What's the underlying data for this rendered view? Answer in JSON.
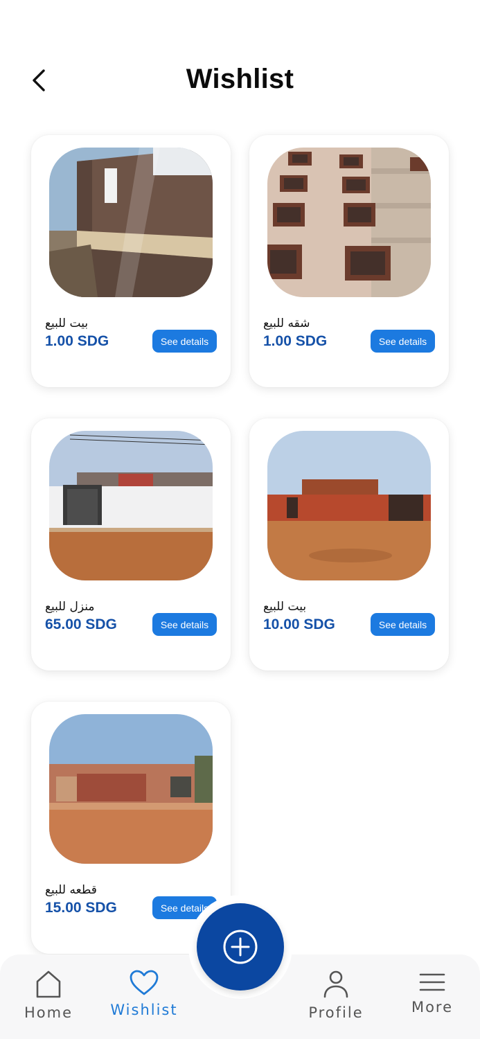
{
  "header": {
    "title": "Wishlist",
    "back_icon": "chevron-left-icon"
  },
  "listings": [
    {
      "name": "بيت للبيع",
      "price": "1.00 SDG",
      "button": "See details",
      "photo": "brick-wall-house-photo"
    },
    {
      "name": "شقه للبيع",
      "price": "1.00 SDG",
      "button": "See details",
      "photo": "apartment-building-photo"
    },
    {
      "name": "منزل للبيع",
      "price": "65.00 SDG",
      "button": "See details",
      "photo": "white-wall-gate-house-photo"
    },
    {
      "name": "بيت للبيع",
      "price": "10.00 SDG",
      "button": "See details",
      "photo": "red-wall-house-photo"
    },
    {
      "name": "قطعه للبيع",
      "price": "15.00 SDG",
      "button": "See details",
      "photo": "empty-land-plot-photo"
    }
  ],
  "colors": {
    "price": "#1551a8",
    "button": "#1c7ae0",
    "fab": "#0b47a1",
    "active_nav": "#1f7ad6"
  },
  "fab": {
    "icon": "plus-circle-icon"
  },
  "bottom_nav": {
    "items": [
      {
        "label": "Home",
        "icon": "home-icon",
        "active": false
      },
      {
        "label": "Wishlist",
        "icon": "heart-icon",
        "active": true
      },
      {
        "label": "Profile",
        "icon": "person-icon",
        "active": false
      },
      {
        "label": "More",
        "icon": "menu-icon",
        "active": false
      }
    ]
  }
}
